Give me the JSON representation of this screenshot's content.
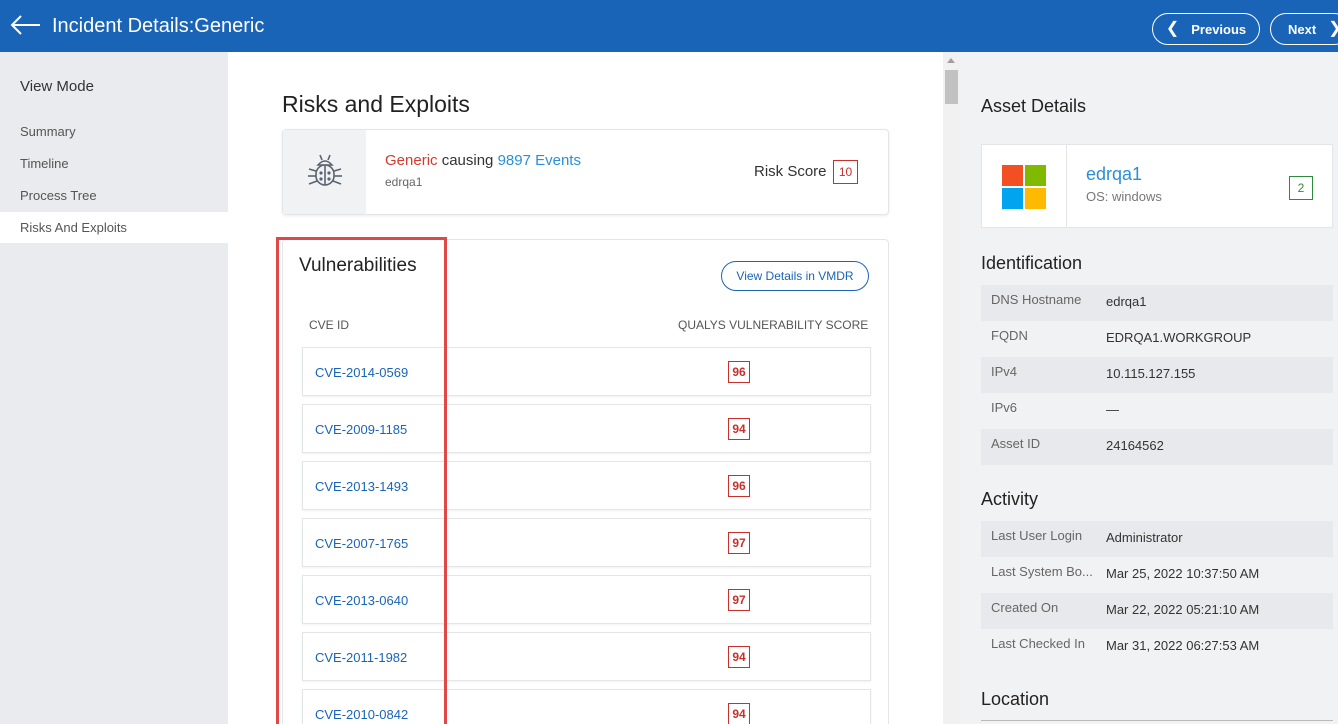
{
  "header": {
    "title": "Incident Details:Generic",
    "prev_label": "Previous",
    "next_label": "Next"
  },
  "sidebar": {
    "heading": "View Mode",
    "items": [
      {
        "label": "Summary"
      },
      {
        "label": "Timeline"
      },
      {
        "label": "Process Tree"
      },
      {
        "label": "Risks And Exploits",
        "active": true
      }
    ]
  },
  "main": {
    "title": "Risks and Exploits",
    "threat": {
      "name": "Generic",
      "connector": " causing ",
      "events": "9897 Events",
      "asset": "edrqa1",
      "risk_label": "Risk Score",
      "risk_score": "10"
    },
    "vulnerabilities": {
      "title": "Vulnerabilities",
      "button_label": "View Details in VMDR",
      "col_cve": "CVE ID",
      "col_score": "QUALYS VULNERABILITY SCORE",
      "rows": [
        {
          "cve": "CVE-2014-0569",
          "score": "96"
        },
        {
          "cve": "CVE-2009-1185",
          "score": "94"
        },
        {
          "cve": "CVE-2013-1493",
          "score": "96"
        },
        {
          "cve": "CVE-2007-1765",
          "score": "97"
        },
        {
          "cve": "CVE-2013-0640",
          "score": "97"
        },
        {
          "cve": "CVE-2011-1982",
          "score": "94"
        },
        {
          "cve": "CVE-2010-0842",
          "score": "94"
        }
      ]
    }
  },
  "asset_details": {
    "heading": "Asset Details",
    "name": "edrqa1",
    "os": "OS: windows",
    "score": "2",
    "logo_colors": [
      "#f25022",
      "#7fba00",
      "#00a4ef",
      "#ffb900"
    ]
  },
  "identification": {
    "heading": "Identification",
    "rows": [
      {
        "key": "DNS Hostname",
        "value": "edrqa1"
      },
      {
        "key": "FQDN",
        "value": "EDRQA1.WORKGROUP"
      },
      {
        "key": "IPv4",
        "value": "10.115.127.155"
      },
      {
        "key": "IPv6",
        "value": "—"
      },
      {
        "key": "Asset ID",
        "value": "24164562"
      }
    ]
  },
  "activity": {
    "heading": "Activity",
    "rows": [
      {
        "key": "Last User Login",
        "value": "Administrator"
      },
      {
        "key": "Last System Bo...",
        "value": "Mar 25, 2022 10:37:50 AM"
      },
      {
        "key": "Created On",
        "value": "Mar 22, 2022 05:21:10 AM"
      },
      {
        "key": "Last Checked In",
        "value": "Mar 31, 2022 06:27:53 AM"
      }
    ]
  },
  "location": {
    "heading": "Location"
  }
}
